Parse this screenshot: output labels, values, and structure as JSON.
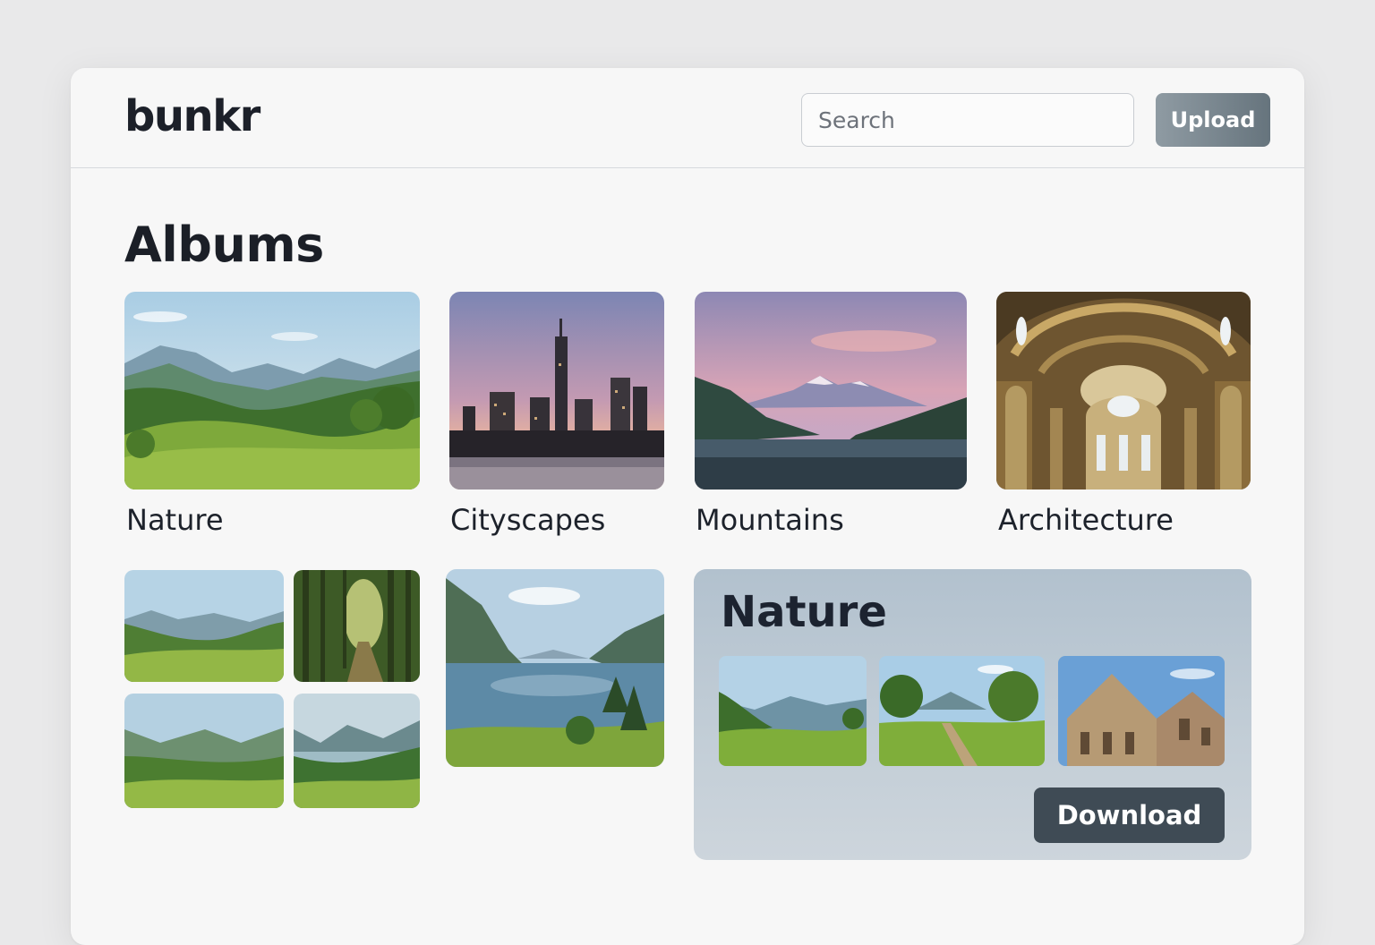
{
  "header": {
    "logo": "bunkr",
    "search_placeholder": "Search",
    "upload_label": "Upload"
  },
  "page_title": "Albums",
  "albums": [
    {
      "label": "Nature",
      "image": "meadow-valley"
    },
    {
      "label": "Cityscapes",
      "image": "city-skyline-sunset"
    },
    {
      "label": "Mountains",
      "image": "snowy-mountain-lake"
    },
    {
      "label": "Architecture",
      "image": "domed-hall-interior"
    }
  ],
  "grid_thumbs": [
    "green-valley",
    "sunlit-forest-path",
    "green-valley-village",
    "mountain-lake-trees",
    "lake-valley"
  ],
  "featured_album": {
    "title": "Nature",
    "thumbs": [
      "green-hills",
      "dirt-path-trees",
      "classical-building"
    ],
    "download_label": "Download"
  },
  "colors": {
    "upload_button": "#76838c",
    "download_button": "#3f4b55",
    "panel_background": "#bfcbd5"
  }
}
